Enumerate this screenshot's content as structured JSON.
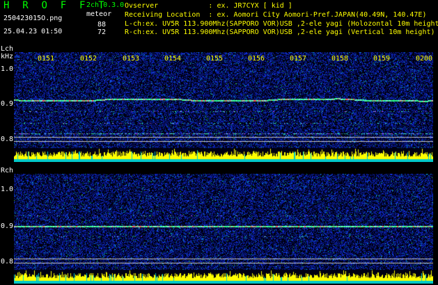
{
  "header": {
    "title": "H R O F F T",
    "channel_mode": "2ch 0.3.0",
    "filename": "250423015O.png",
    "datetime": "25.04.23 01:50",
    "detection_label": "meteor",
    "count_l": "88",
    "count_r": "72"
  },
  "info": {
    "observer": "Ovserver            : ex. JR7CYX [ kid ]",
    "location": "Receiving Location  : ex. Aomori City Aomori-Pref.JAPAN(40.49N, 140.47E)",
    "lch": "L-ch:ex. UV5R 113.900Mhz(SAPPORO VOR)USB ,2-ele yagi (Holozontal 10m height",
    "rch": "R-ch:ex. UV5R 113.900Mhz(SAPPORO VOR)USB ,2-ele yagi (Vertical 10m height)"
  },
  "lch_panel": {
    "label": "Lch",
    "unit": "kHz",
    "y_labels": [
      "1.0",
      "0.9",
      "0.8"
    ],
    "x_ticks": [
      "0151",
      "0152",
      "0153",
      "0154",
      "0155",
      "0156",
      "0157",
      "0158",
      "0159",
      "0200"
    ]
  },
  "rch_panel": {
    "label": "Rch",
    "y_labels": [
      "1.0",
      "0.9",
      "0.8"
    ]
  },
  "colors": {
    "noise_blue": "#1a3cff",
    "level_bar": "#ffff00",
    "level_base": "#00c8c8",
    "label_green": "#00ff00"
  }
}
